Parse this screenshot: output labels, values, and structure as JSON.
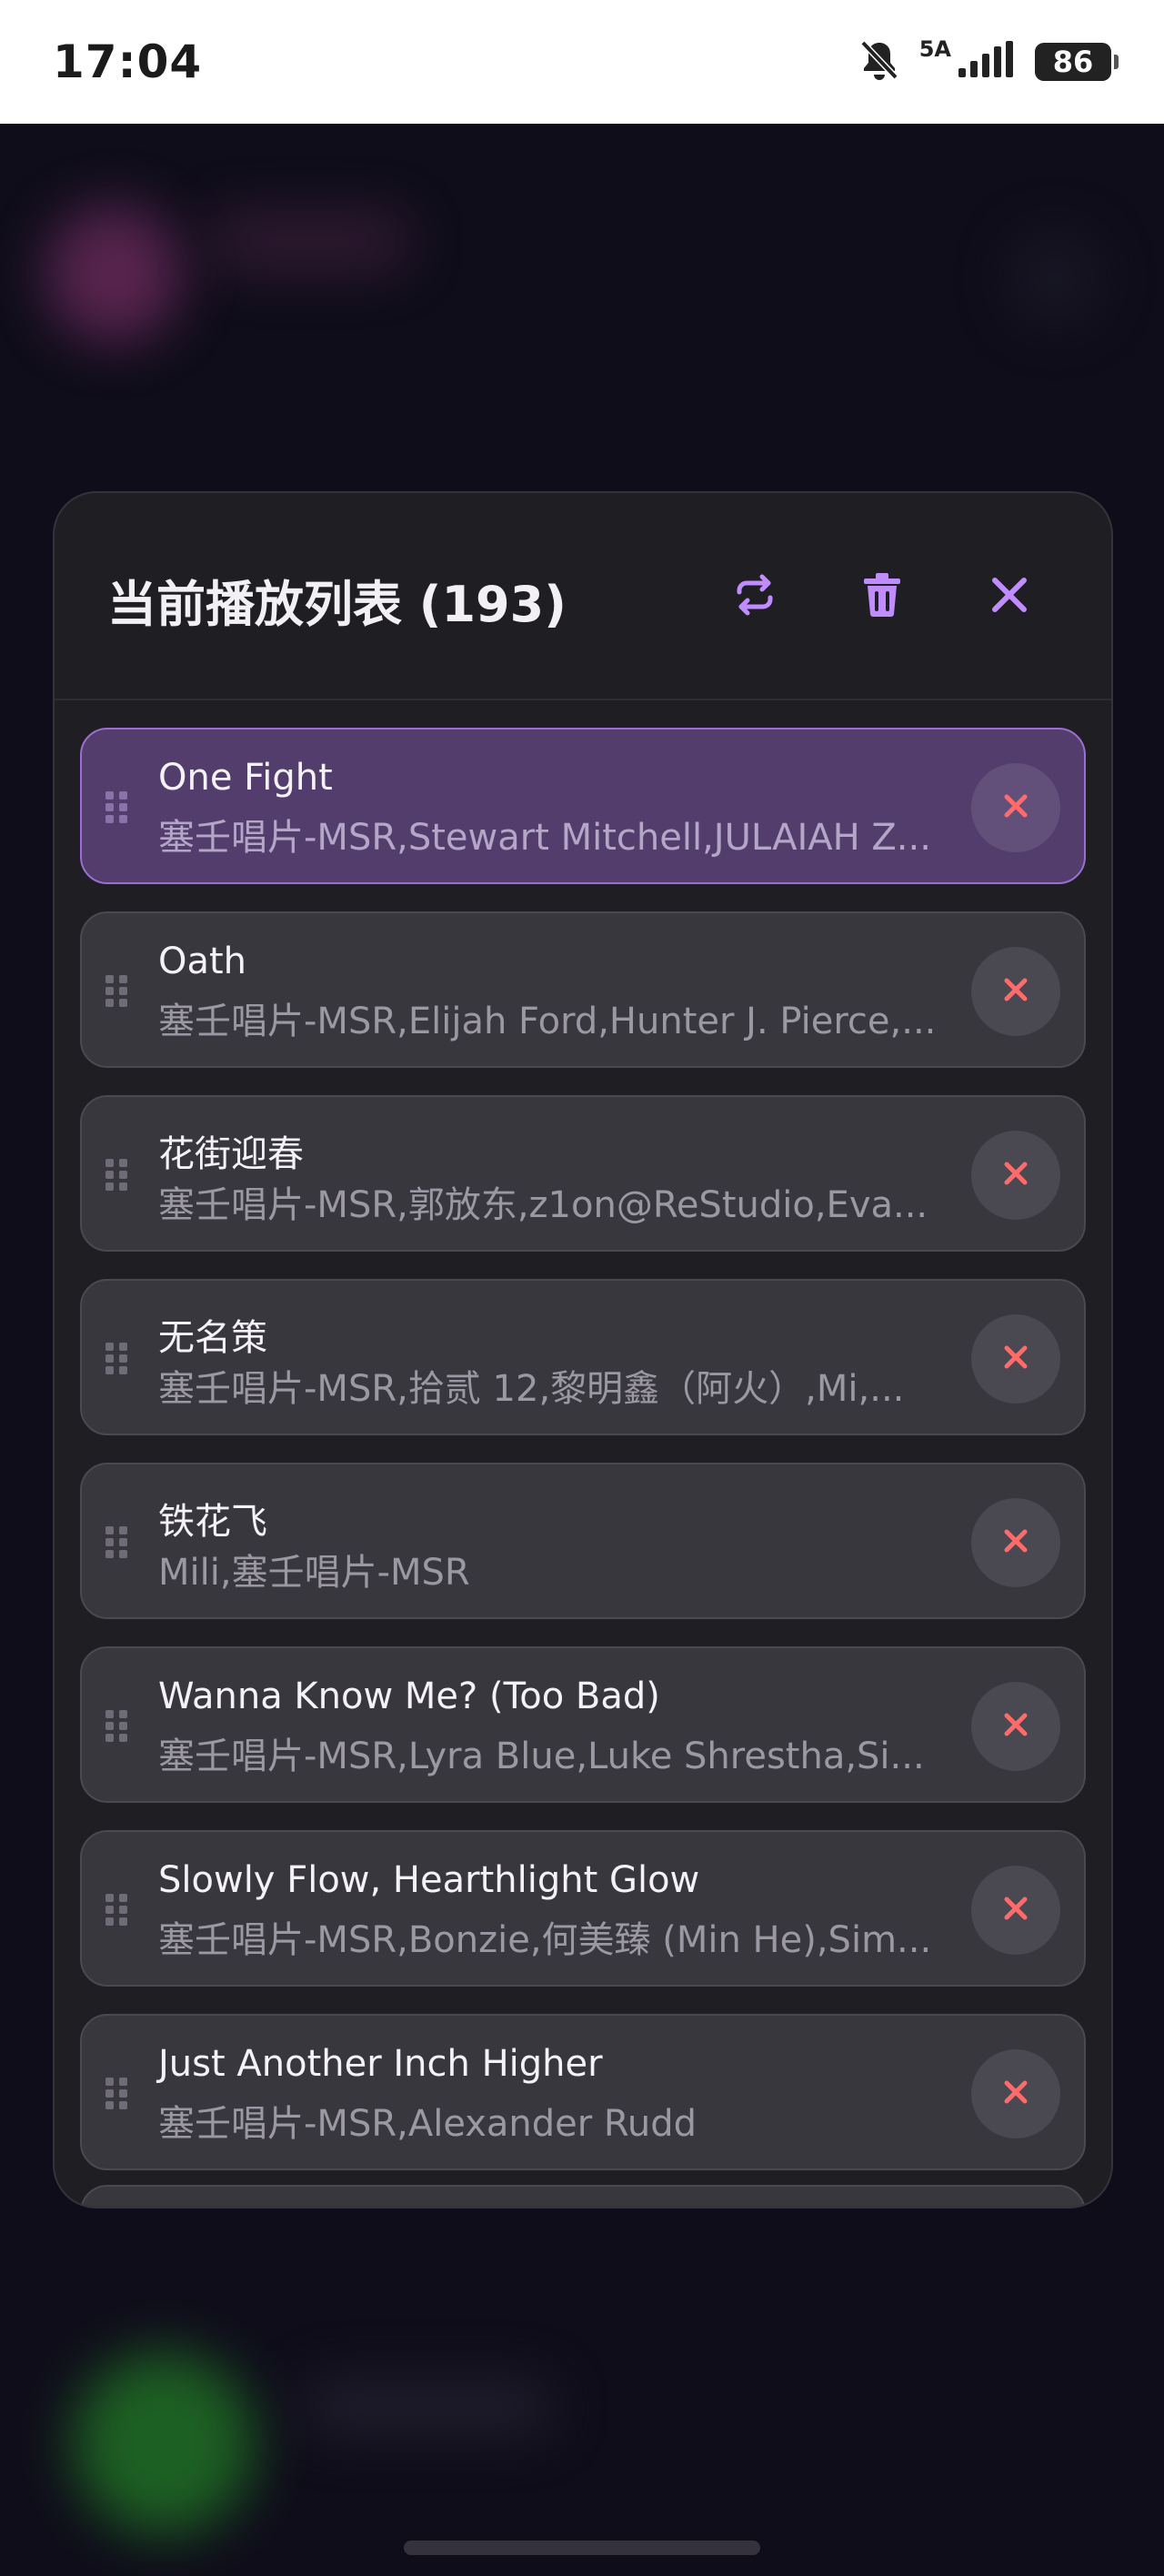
{
  "status_bar": {
    "time": "17:04",
    "network": "5A",
    "battery": "86",
    "icons": [
      "bell-off-icon",
      "signal-icon",
      "battery-icon"
    ]
  },
  "panel": {
    "title": "当前播放列表 (193)",
    "buttons": {
      "repeat_icon": "repeat-icon",
      "clear_icon": "trash-icon",
      "close_icon": "close-icon"
    },
    "accent_color": "#c08cff",
    "remove_color": "#ff6b6b"
  },
  "playlist": [
    {
      "title": "One Fight",
      "artist": "塞壬唱片-MSR,Stewart Mitchell,JULAIAH Z...",
      "active": true
    },
    {
      "title": "Oath",
      "artist": "塞壬唱片-MSR,Elijah Ford,Hunter J. Pierce,...",
      "active": false
    },
    {
      "title": "花街迎春",
      "artist": "塞壬唱片-MSR,郭放东,z1on@ReStudio,Eva...",
      "active": false
    },
    {
      "title": "无名策",
      "artist": "塞壬唱片-MSR,拾贰 12,黎明鑫（阿火）,Mi,...",
      "active": false
    },
    {
      "title": "铁花飞",
      "artist": "Mili,塞壬唱片-MSR",
      "active": false
    },
    {
      "title": "Wanna Know Me? (Too Bad)",
      "artist": "塞壬唱片-MSR,Lyra Blue,Luke Shrestha,Si...",
      "active": false
    },
    {
      "title": "Slowly Flow, Hearthlight Glow",
      "artist": "塞壬唱片-MSR,Bonzie,何美臻 (Min He),Sim...",
      "active": false
    },
    {
      "title": "Just Another Inch Higher",
      "artist": "塞壬唱片-MSR,Alexander Rudd",
      "active": false
    }
  ]
}
